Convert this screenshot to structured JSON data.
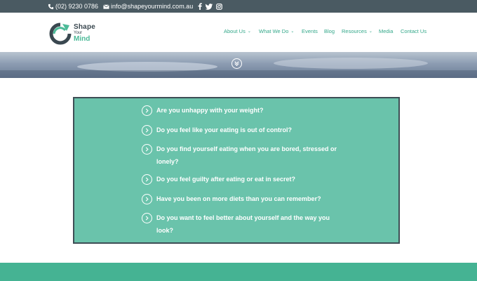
{
  "topbar": {
    "phone": "(02) 9230 0786",
    "email": "info@shapeyourmind.com.au",
    "social": [
      {
        "icon": "facebook-icon",
        "glyph": "f"
      },
      {
        "icon": "twitter-icon",
        "glyph": "t"
      },
      {
        "icon": "instagram-icon",
        "glyph": "◻"
      }
    ]
  },
  "logo": {
    "line1": "Shape",
    "line2": "Your",
    "line3": "Mind"
  },
  "nav": {
    "items": [
      {
        "label": "About Us",
        "has_dropdown": true
      },
      {
        "label": "What We Do",
        "has_dropdown": true
      },
      {
        "label": "Events",
        "has_dropdown": false
      },
      {
        "label": "Blog",
        "has_dropdown": false
      },
      {
        "label": "Resources",
        "has_dropdown": true
      },
      {
        "label": "Media",
        "has_dropdown": false
      },
      {
        "label": "Contact Us",
        "has_dropdown": false
      }
    ]
  },
  "questions": [
    "Are you unhappy with your weight?",
    "Do you feel like your eating is out of control?",
    "Do you find yourself eating when you are bored, stressed or lonely?",
    "Do you feel guilty after eating or eat in secret?",
    "Have you been on more diets than you can remember?",
    "Do you want to feel better about yourself and the way you look?"
  ],
  "colors": {
    "topbar": "#4a5a62",
    "accent": "#34a88a",
    "question_box": "#6ac3ab",
    "question_border": "#3e4e55",
    "bottom_band": "#45b393"
  }
}
